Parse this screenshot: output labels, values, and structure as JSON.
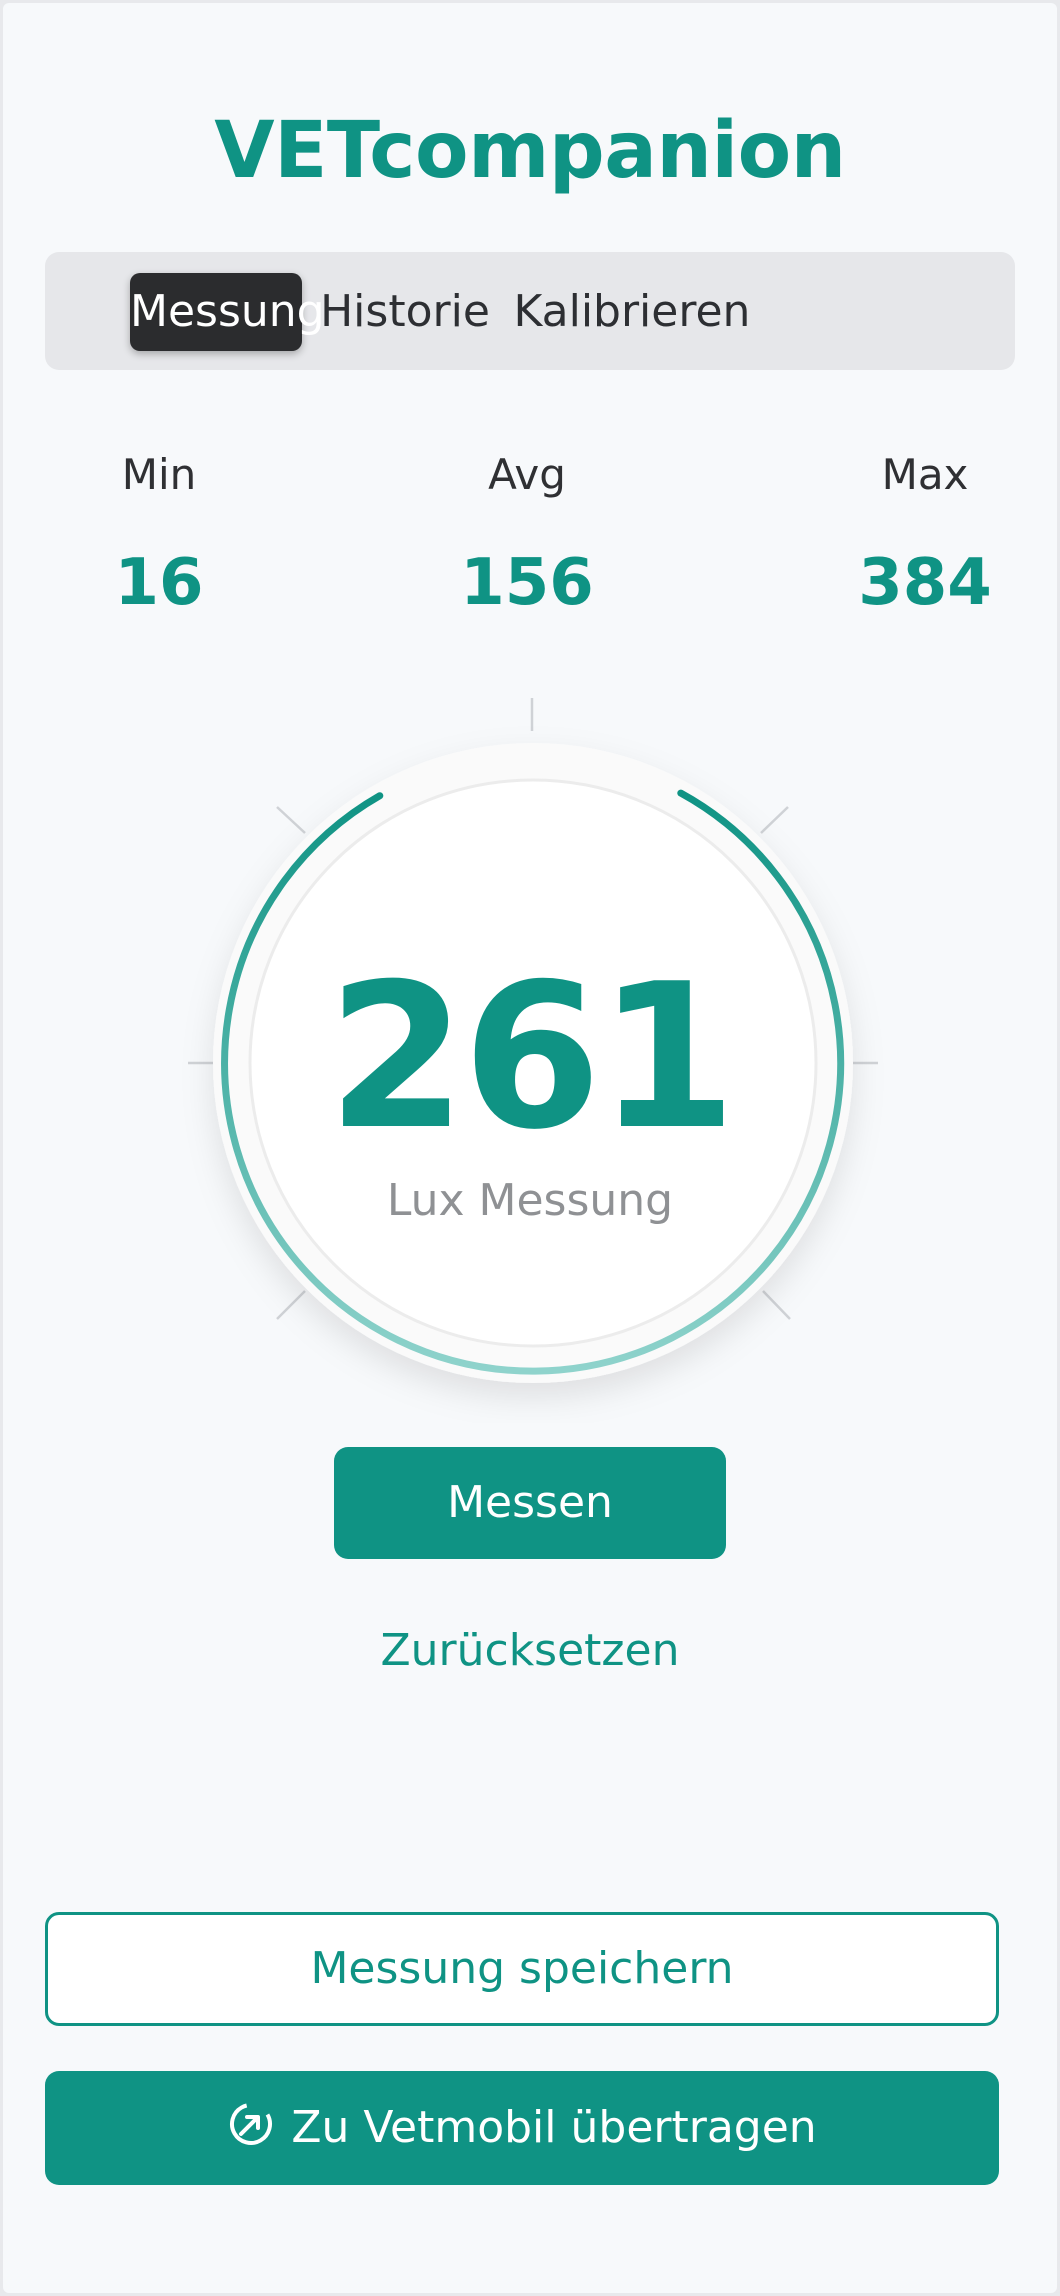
{
  "app": {
    "title": "VETcompanion"
  },
  "tabs": [
    {
      "label": "Messung",
      "active": true
    },
    {
      "label": "Historie",
      "active": false
    },
    {
      "label": "Kalibrieren",
      "active": false
    }
  ],
  "stats": {
    "min": {
      "label": "Min",
      "value": "16"
    },
    "avg": {
      "label": "Avg",
      "value": "156"
    },
    "max": {
      "label": "Max",
      "value": "384"
    }
  },
  "gauge": {
    "reading": "261",
    "unit_label": "Lux Messung",
    "accent_color": "#0f9384",
    "light_accent_color": "#8fd3cc"
  },
  "actions": {
    "measure_label": "Messen",
    "reset_label": "Zurücksetzen",
    "save_label": "Messung speichern",
    "transfer_label": "Zu Vetmobil übertragen",
    "transfer_icon": "share-arrow-icon"
  },
  "colors": {
    "primary": "#0f9384",
    "segment_active_bg": "#2b2c2e",
    "background": "#f7f9fb"
  }
}
